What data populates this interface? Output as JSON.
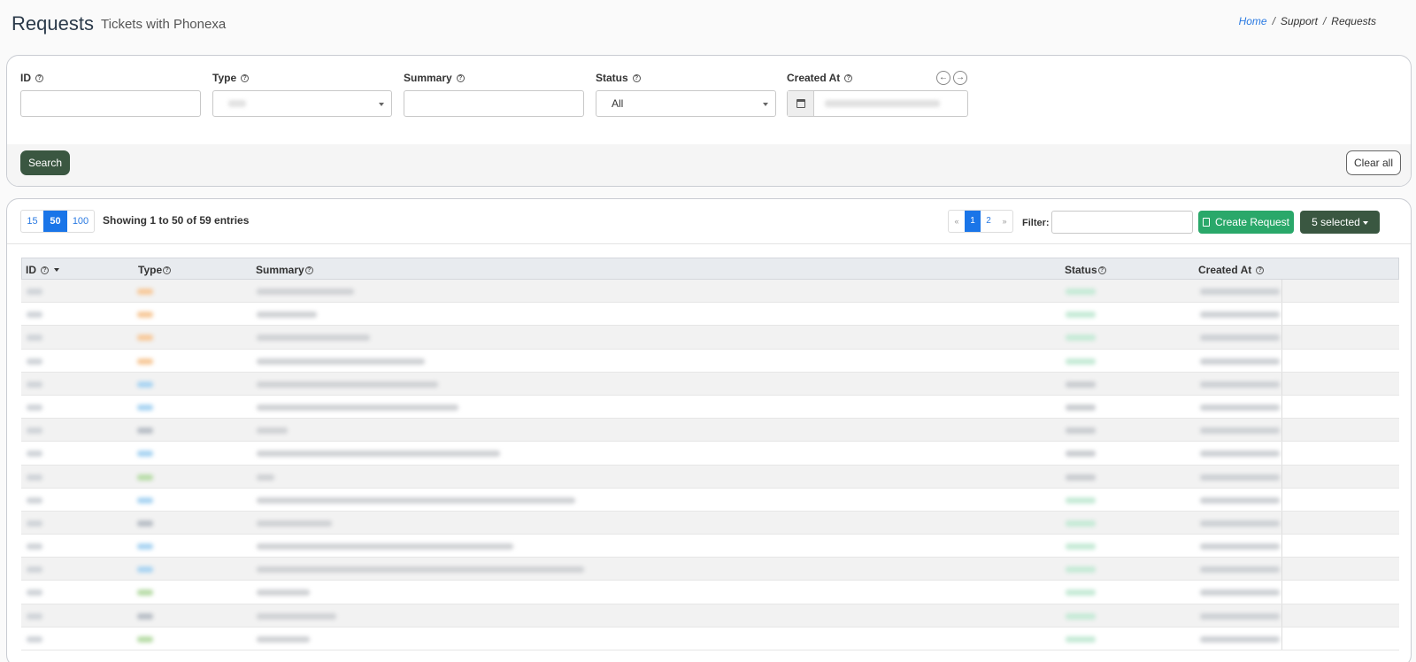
{
  "header": {
    "title": "Requests",
    "subtitle": "Tickets with Phonexa",
    "breadcrumb": [
      "Home",
      "Support",
      "Requests"
    ]
  },
  "filters": {
    "id_label": "ID",
    "type_label": "Type",
    "summary_label": "Summary",
    "status_label": "Status",
    "status_value": "All",
    "created_label": "Created At",
    "search_button": "Search",
    "clear_button": "Clear all"
  },
  "table_controls": {
    "page_sizes": [
      "15",
      "50",
      "100"
    ],
    "active_page_size": "50",
    "showing_text": "Showing 1 to 50 of 59 entries",
    "pages": [
      "«",
      "1",
      "2",
      "»"
    ],
    "active_page": "1",
    "filter_label": "Filter:",
    "create_button": "Create Request",
    "selected_button": "5 selected"
  },
  "table": {
    "columns": [
      "ID",
      "Type",
      "Summary",
      "Status",
      "Created At"
    ],
    "row_count_visible": 16,
    "type_colors": [
      "#f7c99a",
      "#f7c99a",
      "#f7c99a",
      "#f7c99a",
      "#a9d4f2",
      "#a9d4f2",
      "#b8bec6",
      "#a9d4f2",
      "#b8dca8",
      "#a9d4f2",
      "#b8bec6",
      "#a9d4f2",
      "#a9d4f2",
      "#b8dca8",
      "#b8bec6",
      "#b8dca8"
    ],
    "status_colors": [
      "#c5ead6",
      "#c5ead6",
      "#c5ead6",
      "#c5ead6",
      "#c9ccd0",
      "#c9ccd0",
      "#c9ccd0",
      "#c9ccd0",
      "#c9ccd0",
      "#c5ead6",
      "#c5ead6",
      "#c5ead6",
      "#c5ead6",
      "#c5ead6",
      "#c5ead6",
      "#c5ead6"
    ]
  },
  "colors": {
    "primary_dark_green": "#3a5741",
    "create_green": "#2aa86a",
    "link_blue": "#2a7ae2",
    "active_blue": "#1a75e8"
  }
}
